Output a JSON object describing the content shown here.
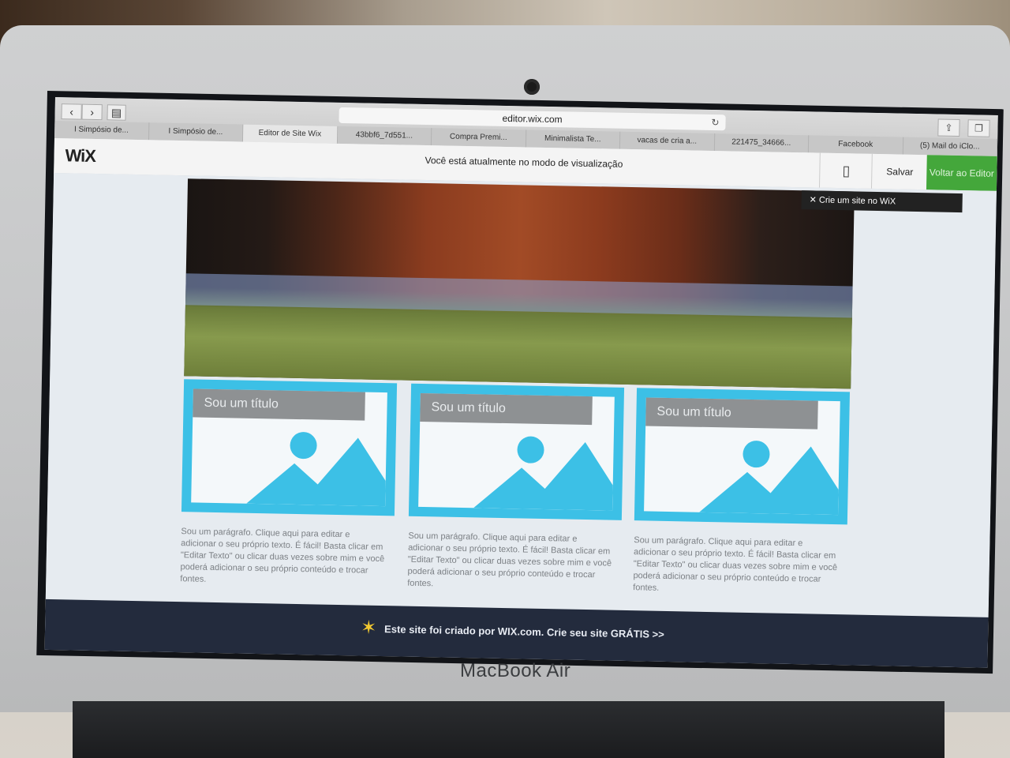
{
  "browser": {
    "address": "editor.wix.com",
    "tabs": [
      "I Simpósio de...",
      "I Simpósio de...",
      "Editor de Site Wix",
      "43bbf6_7d551...",
      "Compra Premi...",
      "Minimalista Te...",
      "vacas de cria a...",
      "221475_34666...",
      "Facebook",
      "(5) Mail do iClo..."
    ],
    "active_tab_index": 2
  },
  "wix_bar": {
    "logo": "WiX",
    "preview_notice": "Você está atualmente no modo de visualização",
    "save_label": "Salvar",
    "back_label": "Voltar ao Editor",
    "create_site_tip": "Crie um site no WiX"
  },
  "cards": [
    {
      "title": "Sou um título",
      "paragraph": "Sou um parágrafo. Clique aqui para editar e adicionar o seu próprio texto. É fácil! Basta clicar em \"Editar Texto\" ou clicar duas vezes sobre mim e você poderá adicionar o seu próprio conteúdo e trocar fontes."
    },
    {
      "title": "Sou um título",
      "paragraph": "Sou um parágrafo. Clique aqui para editar e adicionar o seu próprio texto. É fácil! Basta clicar em \"Editar Texto\" ou clicar duas vezes sobre mim e você poderá adicionar o seu próprio conteúdo e trocar fontes."
    },
    {
      "title": "Sou um título",
      "paragraph": "Sou um parágrafo. Clique aqui para editar e adicionar o seu próprio texto. É fácil! Basta clicar em \"Editar Texto\" ou clicar duas vezes sobre mim e você poderá adicionar o seu próprio conteúdo e trocar fontes."
    }
  ],
  "footer": {
    "text": "Este site foi criado por WIX.com. Crie seu site GRÁTIS >>"
  },
  "device": {
    "label": "MacBook Air"
  },
  "colors": {
    "accent_blue": "#3cc0e6",
    "wix_green": "#44a73b",
    "footer_navy": "#232b3d"
  }
}
